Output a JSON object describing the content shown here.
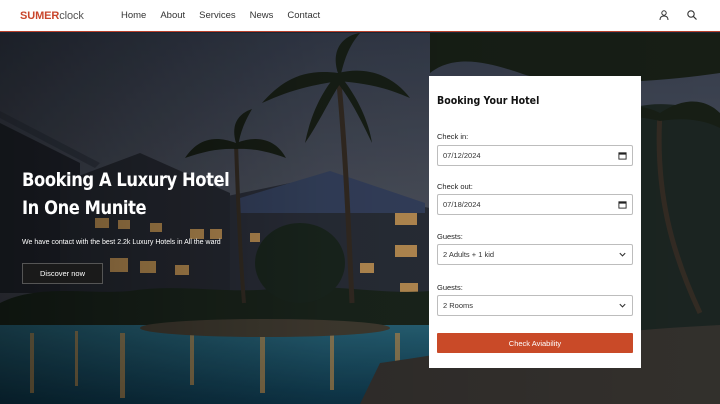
{
  "nav": {
    "logo_brand": "SUMER",
    "logo_suffix": "clock",
    "links": [
      "Home",
      "About",
      "Services",
      "News",
      "Contact"
    ],
    "icons": [
      "user-icon",
      "search-icon"
    ]
  },
  "hero": {
    "title_line1": "Booking A Luxury Hotel",
    "title_line2": "In One Munite",
    "subtitle": "We have contact with the best 2.2k Luxury Hotels in All the ward",
    "cta_label": "Discover now"
  },
  "booking": {
    "title": "Booking Your Hotel",
    "checkin_label": "Check in:",
    "checkin_value": "07/12/2024",
    "checkout_label": "Check out:",
    "checkout_value": "07/18/2024",
    "guests_label": "Guests:",
    "guests_value": "2 Adults + 1 kid",
    "rooms_label": "Guests:",
    "rooms_value": "2 Rooms",
    "submit_label": "Check Aviability"
  },
  "colors": {
    "accent": "#c94a28",
    "logo": "#c9462c",
    "nav_border": "#b8402a"
  }
}
